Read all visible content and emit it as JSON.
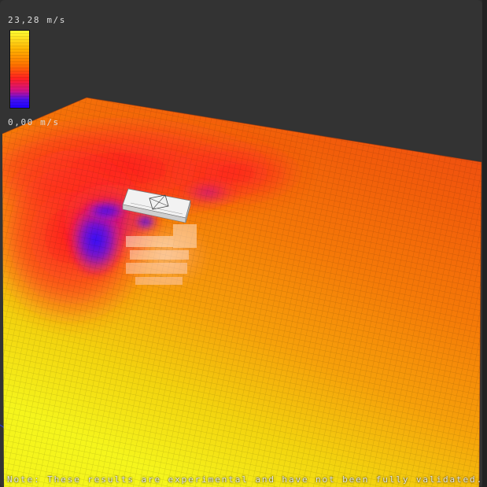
{
  "legend": {
    "max_label": "23,28 m/s",
    "min_label": "0,00 m/s",
    "gradient_colors": [
      "#ffff33",
      "#ffb000",
      "#ff7000",
      "#ff2020",
      "#d0108a",
      "#4010f0",
      "#2000ff"
    ]
  },
  "note": {
    "text": "Note: These results are experimental and have not been fully validated."
  },
  "colors": {
    "background": "#333333",
    "low_speed": "#2a18ff",
    "mid_speed": "#ff1a1a",
    "high_speed": "#f0f020",
    "building": "#e8e8e8"
  }
}
